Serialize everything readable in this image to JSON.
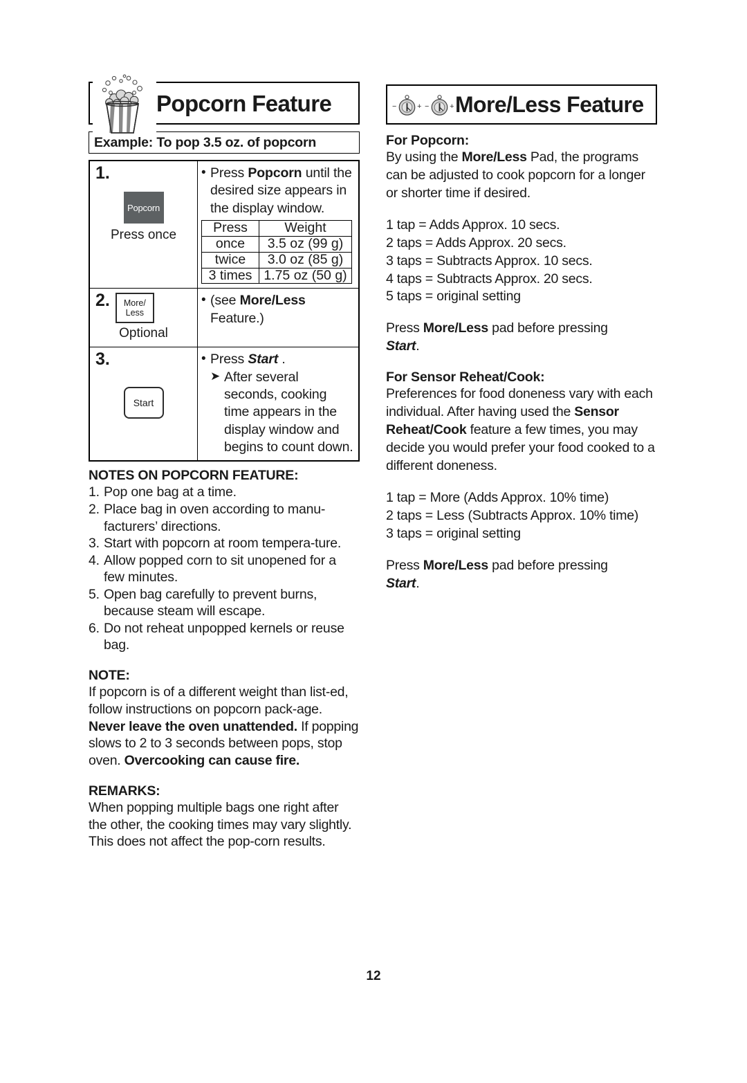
{
  "page": {
    "number": "12"
  },
  "left_column": {
    "header": {
      "title": "Popcorn Feature",
      "icon": "popcorn-bucket-icon"
    },
    "example_bar": "Example: To pop 3.5 oz. of popcorn",
    "steps": [
      {
        "number": "1.",
        "key_label": "Popcorn",
        "caption": "Press once",
        "bullet": "Press ",
        "bullet_bold": "Popcorn",
        "bullet_tail": " until the desired size appears in the display window."
      },
      {
        "number": "2.",
        "key_label_line1": "More/",
        "key_label_line2": "Less",
        "caption": "Optional",
        "bullet": "(see ",
        "bullet_bold": "More/Less",
        "bullet_tail": " Feature.)"
      },
      {
        "number": "3.",
        "key_label": "Start",
        "caption": "",
        "bullet": "Press ",
        "bullet_bold": "Start",
        "bullet_tail": " .",
        "arrow_text": "After several seconds, cooking time appears in the display window and begins to count down."
      }
    ],
    "press_weight_table": {
      "columns": [
        "Press",
        "Weight"
      ],
      "rows": [
        [
          "once",
          "3.5 oz (99 g)"
        ],
        [
          "twice",
          "3.0 oz (85 g)"
        ],
        [
          "3 times",
          "1.75 oz (50 g)"
        ]
      ]
    },
    "notes_heading": "NOTES ON POPCORN FEATURE:",
    "notes": [
      {
        "n": "1.",
        "text": "Pop one bag at a time."
      },
      {
        "n": "2.",
        "text": "Place bag in oven according to manu-facturers’ directions."
      },
      {
        "n": "3.",
        "text": "Start with popcorn at room tempera-ture."
      },
      {
        "n": "4.",
        "text": "Allow popped corn to sit unopened for a few minutes."
      },
      {
        "n": "5.",
        "text": "Open bag carefully to prevent burns, because steam will escape."
      },
      {
        "n": "6.",
        "text": "Do not reheat unpopped kernels or reuse bag."
      }
    ],
    "note_heading": "NOTE:",
    "note_body_1": "If popcorn is of a different weight than list-ed, follow instructions on popcorn pack-age. ",
    "note_bold_1": "Never leave the oven unattended.",
    "note_body_2": " If popping slows to 2 to 3 seconds between pops, stop oven. ",
    "note_bold_2": "Overcooking can cause fire.",
    "remarks_heading": "REMARKS:",
    "remarks_body": "When popping multiple bags one right after the other, the cooking times may vary slightly. This does not affect the pop-corn results."
  },
  "right_column": {
    "header": {
      "title": "More/Less Feature",
      "icon_1": "dial-minus-plus-icon",
      "icon_2": "dial-minus-plus-icon"
    },
    "popcorn_heading": "For Popcorn:",
    "popcorn_body_pre": "By using the ",
    "popcorn_body_bold": "More/Less",
    "popcorn_body_post": " Pad, the programs can be adjusted to cook popcorn for a longer or shorter time if desired.",
    "popcorn_taps": [
      "1 tap = Adds Approx. 10 secs.",
      "2 taps = Adds Approx. 20 secs.",
      "3 taps = Subtracts Approx. 10 secs.",
      "4 taps = Subtracts Approx. 20 secs.",
      "5 taps = original setting"
    ],
    "press_note_1": {
      "pre": "Press ",
      "bold": "More/Less",
      "post": " pad before pressing",
      "start": "Start",
      "period": "."
    },
    "sensor_heading": "For Sensor Reheat/Cook:",
    "sensor_body_pre": "Preferences for food doneness vary with each individual. After having used the ",
    "sensor_body_bold": "Sensor Reheat/Cook",
    "sensor_body_post": " feature a few times, you may decide you would prefer your food cooked to a different doneness.",
    "sensor_taps": [
      "1 tap = More (Adds Approx. 10% time)",
      "2 taps = Less (Subtracts Approx. 10% time)",
      "3 taps = original setting"
    ],
    "press_note_2": {
      "pre": "Press ",
      "bold": "More/Less",
      "post": " pad before pressing",
      "start": "Start",
      "period": "."
    }
  }
}
